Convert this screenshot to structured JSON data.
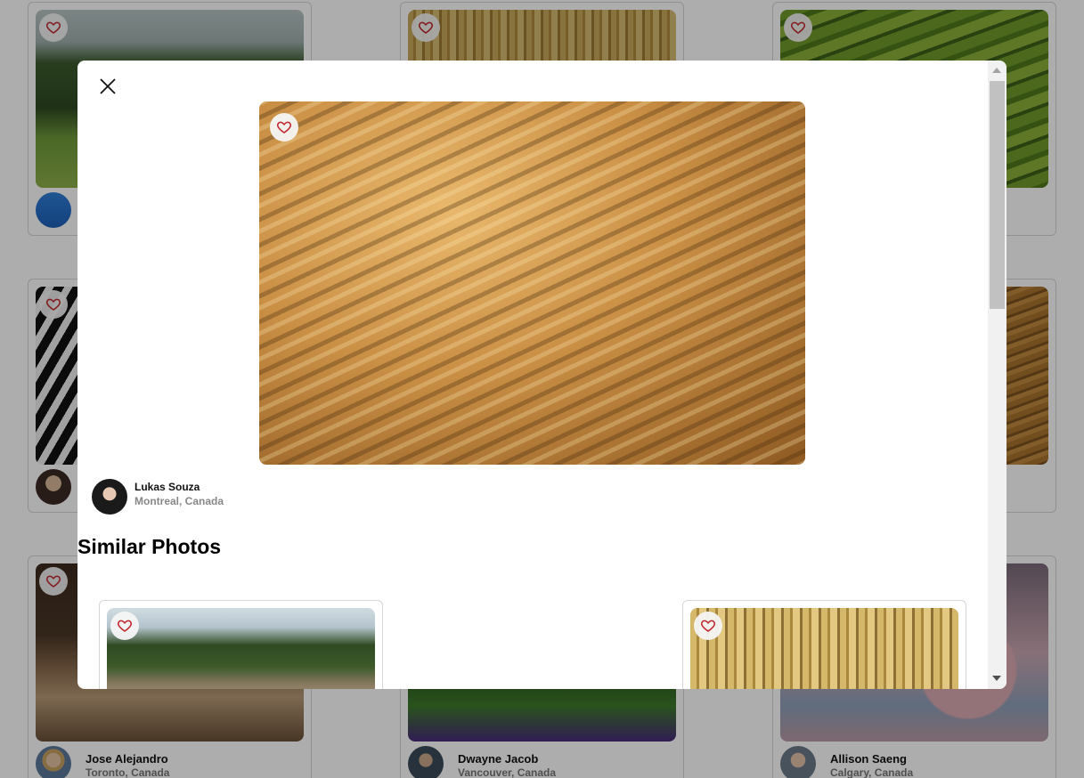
{
  "gallery": {
    "cards": [
      {
        "owner": "",
        "location": ""
      },
      {
        "owner": "",
        "location": ""
      },
      {
        "owner": "",
        "location": ""
      },
      {
        "owner": "",
        "location": ""
      },
      {
        "owner": "",
        "location": ""
      },
      {
        "owner": "Jose Alejandro",
        "location": "Toronto, Canada"
      },
      {
        "owner": "Dwayne Jacob",
        "location": "Vancouver, Canada"
      },
      {
        "owner": "Allison Saeng",
        "location": "Calgary, Canada"
      }
    ]
  },
  "modal": {
    "photo": {
      "owner": "Lukas Souza",
      "location": "Montreal, Canada"
    },
    "similar_title": "Similar Photos"
  },
  "icons": {
    "heart": "heart-outline-icon",
    "close": "close-icon"
  },
  "colors": {
    "heart": "#c0262d",
    "overlay": "rgba(0,0,0,0.32)"
  }
}
